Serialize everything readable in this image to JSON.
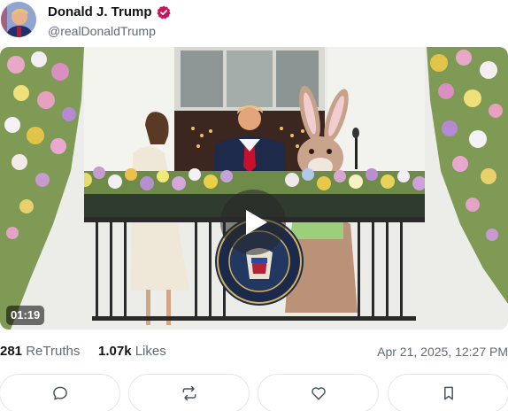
{
  "post": {
    "author": {
      "display_name": "Donald J. Trump",
      "handle": "@realDonaldTrump",
      "verified": true,
      "verified_color": "#c2185b"
    },
    "media": {
      "type": "video",
      "duration": "01:19",
      "seal_text": "SEAL OF THE PRESIDENT OF THE UNITED STATES"
    },
    "stats": {
      "retruths_count": "281",
      "retruths_label": "ReTruths",
      "likes_count": "1.07k",
      "likes_label": "Likes"
    },
    "timestamp": "Apr 21, 2025, 12:27 PM",
    "actions": [
      {
        "name": "reply",
        "icon": "comment-icon"
      },
      {
        "name": "retruth",
        "icon": "repost-icon"
      },
      {
        "name": "like",
        "icon": "heart-icon"
      },
      {
        "name": "bookmark",
        "icon": "bookmark-icon"
      }
    ]
  },
  "colors": {
    "icon_gray": "#4a5563",
    "text_secondary": "#5e6b78",
    "border": "#e2e5ea"
  }
}
